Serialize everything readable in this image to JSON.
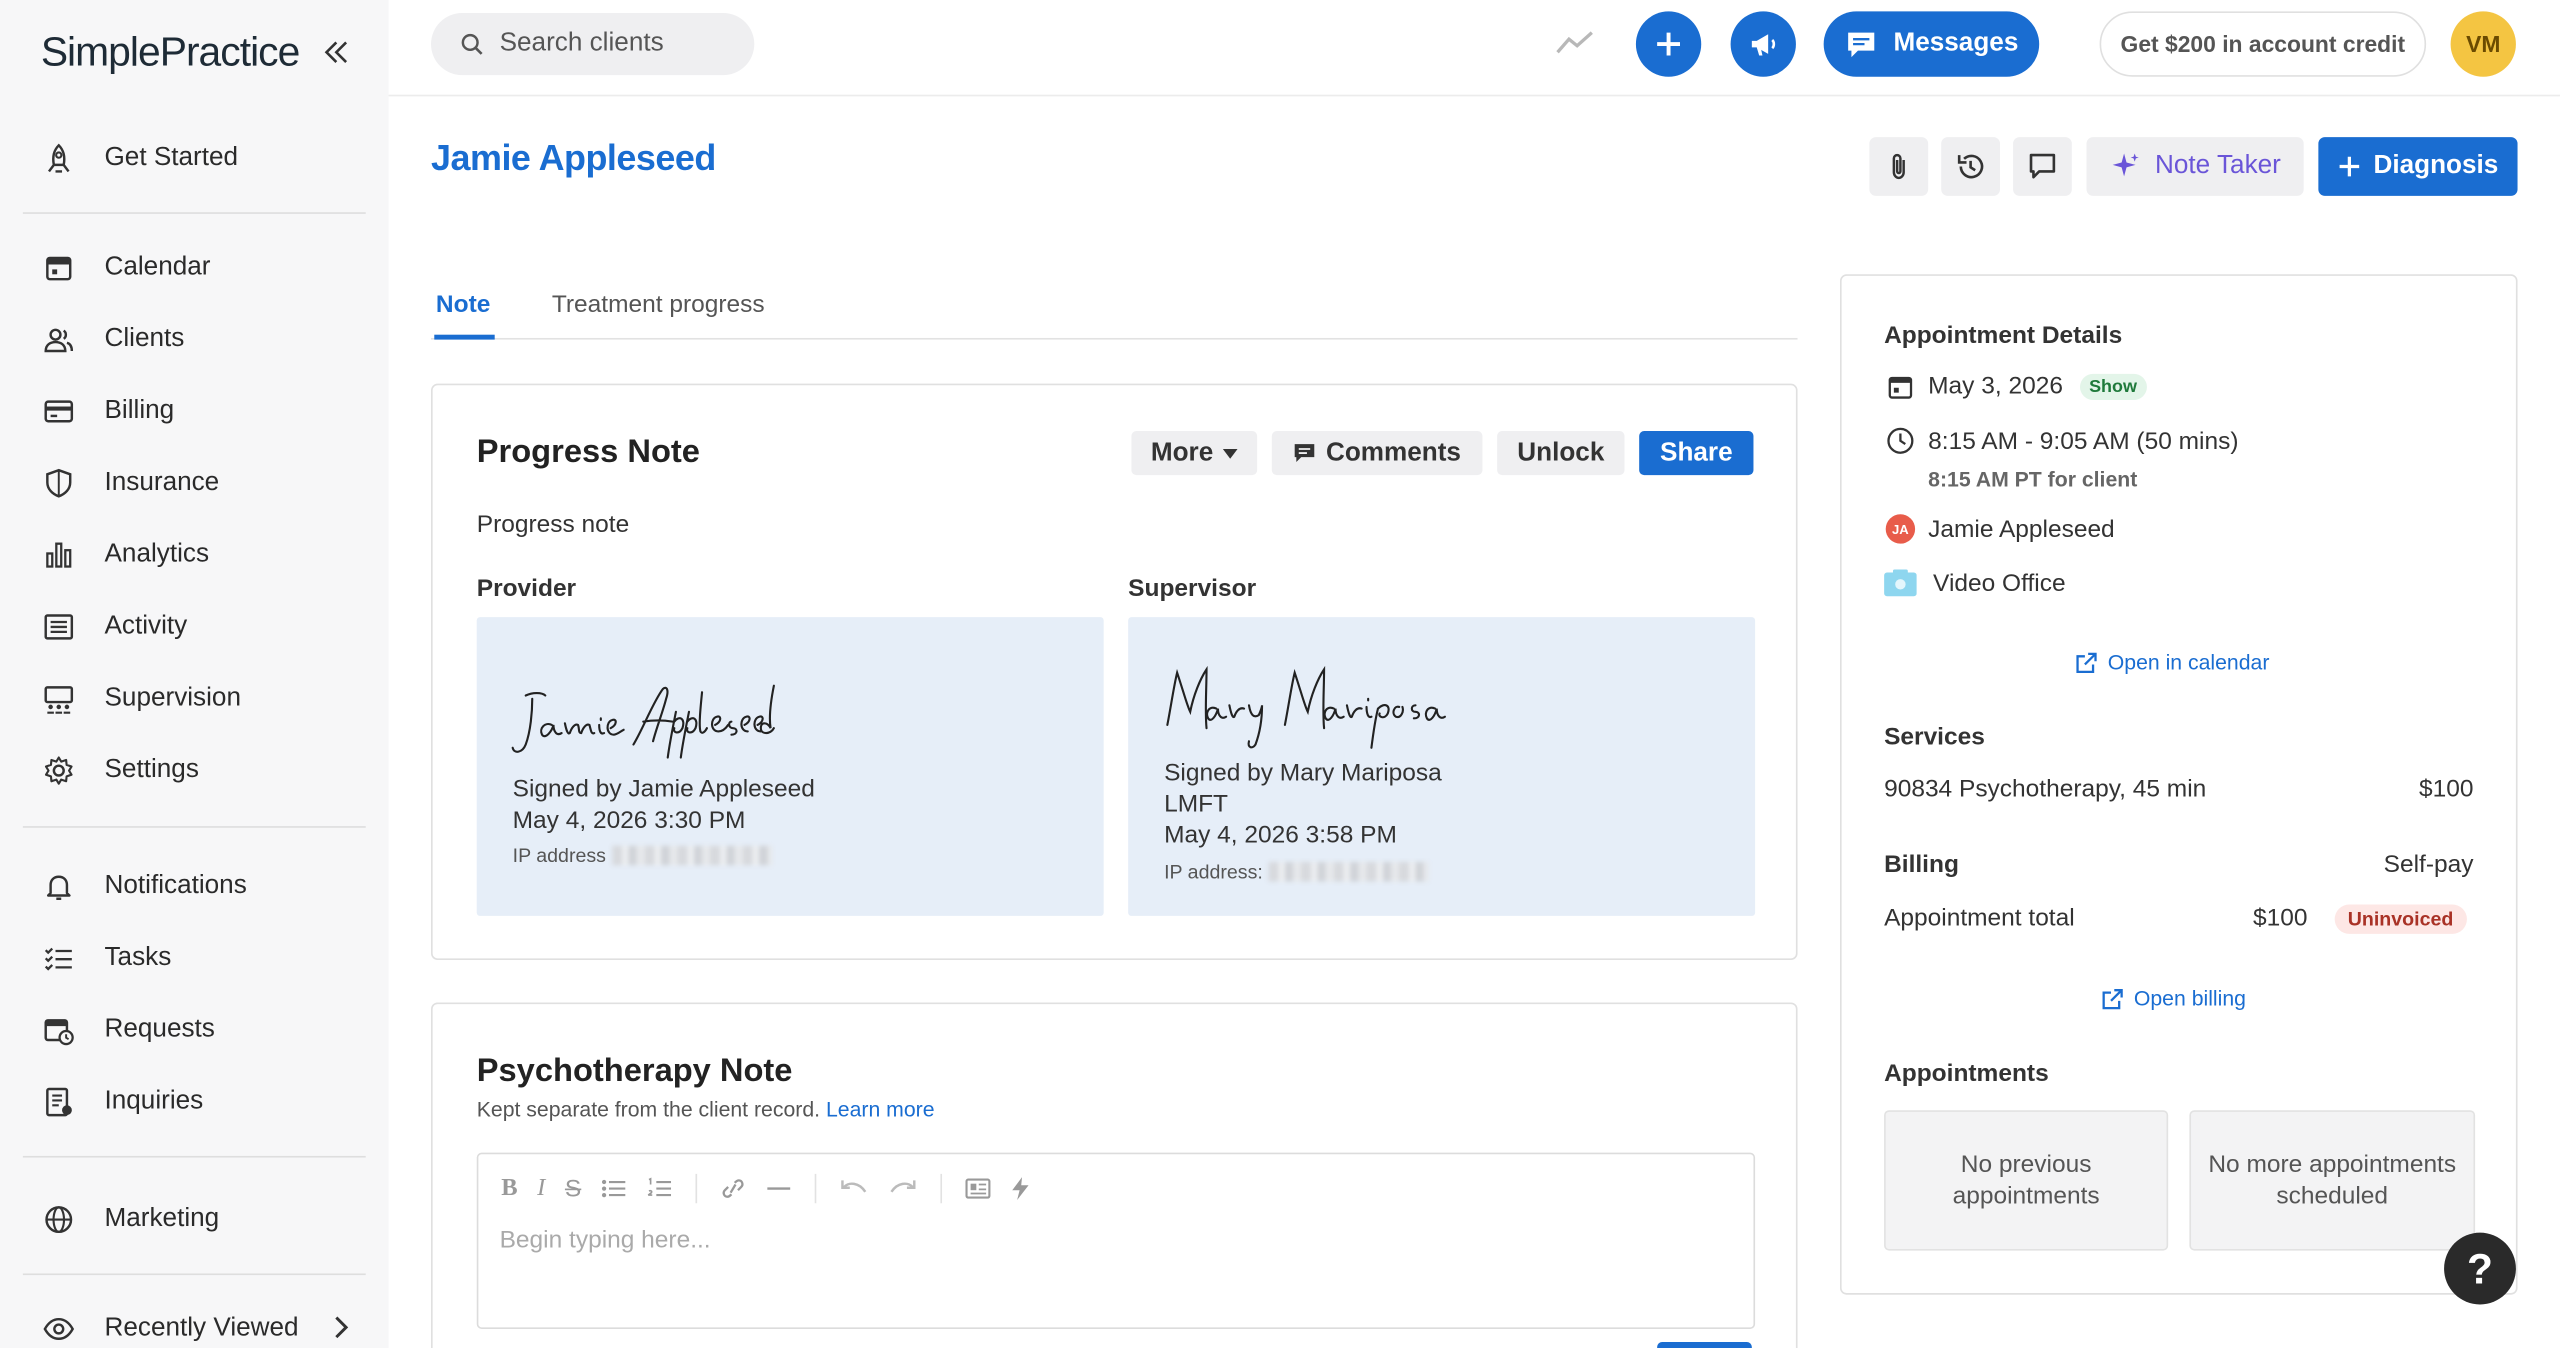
{
  "app": {
    "logo": "SimplePractice"
  },
  "sidebar": {
    "items": [
      {
        "id": "get-started",
        "label": "Get Started"
      },
      {
        "id": "calendar",
        "label": "Calendar"
      },
      {
        "id": "clients",
        "label": "Clients"
      },
      {
        "id": "billing",
        "label": "Billing"
      },
      {
        "id": "insurance",
        "label": "Insurance"
      },
      {
        "id": "analytics",
        "label": "Analytics"
      },
      {
        "id": "activity",
        "label": "Activity"
      },
      {
        "id": "supervision",
        "label": "Supervision"
      },
      {
        "id": "settings",
        "label": "Settings"
      },
      {
        "id": "notifications",
        "label": "Notifications"
      },
      {
        "id": "tasks",
        "label": "Tasks"
      },
      {
        "id": "requests",
        "label": "Requests"
      },
      {
        "id": "inquiries",
        "label": "Inquiries"
      },
      {
        "id": "marketing",
        "label": "Marketing"
      },
      {
        "id": "recently-viewed",
        "label": "Recently Viewed"
      }
    ]
  },
  "topbar": {
    "search_placeholder": "Search clients",
    "messages_label": "Messages",
    "credit_label": "Get $200 in account credit",
    "avatar_initials": "VM"
  },
  "header": {
    "client_name": "Jamie Appleseed",
    "note_taker_label": "Note Taker",
    "diagnosis_label": "Diagnosis"
  },
  "tabs": {
    "note": "Note",
    "treatment": "Treatment progress"
  },
  "progress_note": {
    "title": "Progress Note",
    "more_label": "More",
    "comments_label": "Comments",
    "unlock_label": "Unlock",
    "share_label": "Share",
    "subtitle": "Progress note",
    "provider": {
      "label": "Provider",
      "signed_by": "Signed by Jamie Appleseed",
      "date": "May 4, 2026 3:30 PM",
      "ip_label": "IP address"
    },
    "supervisor": {
      "label": "Supervisor",
      "signed_by": "Signed by Mary Mariposa",
      "credential": "LMFT",
      "date": "May 4, 2026 3:58 PM",
      "ip_label": "IP address:"
    }
  },
  "psychotherapy_note": {
    "title": "Psychotherapy Note",
    "subtitle": "Kept separate from the client record.",
    "learn_more": "Learn more",
    "placeholder": "Begin typing here..."
  },
  "appointment": {
    "heading": "Appointment Details",
    "date": "May 3, 2026",
    "status": "Show",
    "time": "8:15 AM - 9:05 AM (50 mins)",
    "client_time": "8:15 AM PT for client",
    "client_initials": "JA",
    "client_name": "Jamie Appleseed",
    "location": "Video Office",
    "open_calendar": "Open in calendar",
    "services_heading": "Services",
    "service_name": "90834 Psychotherapy, 45 min",
    "service_price": "$100",
    "billing_heading": "Billing",
    "billing_type": "Self-pay",
    "total_label": "Appointment total",
    "total_value": "$100",
    "invoice_status": "Uninvoiced",
    "open_billing": "Open billing",
    "appointments_heading": "Appointments",
    "no_previous": "No previous appointments",
    "no_more": "No more appointments scheduled"
  },
  "help_label": "?",
  "colors": {
    "primary": "#1a6dd1",
    "note_taker": "#6a55d8",
    "avatar": "#f4c542"
  }
}
